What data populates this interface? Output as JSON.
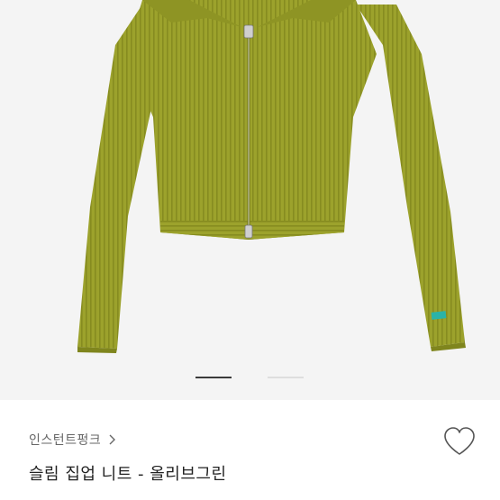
{
  "product": {
    "shop_name": "인스턴트펑크",
    "title": "슬림 집업 니트 - 올리브그린",
    "image_icon": "olive-green-zip-up-knit-cardigan"
  },
  "carousel": {
    "count": 2,
    "active_index": 0
  },
  "icons": {
    "shop_chevron": "chevron-right-icon",
    "like": "heart-outline-icon"
  },
  "colors": {
    "knit": "#9ca22c",
    "background": "#f4f4f4",
    "indicator_active": "#3a3a3a",
    "indicator_inactive": "#dedede"
  }
}
